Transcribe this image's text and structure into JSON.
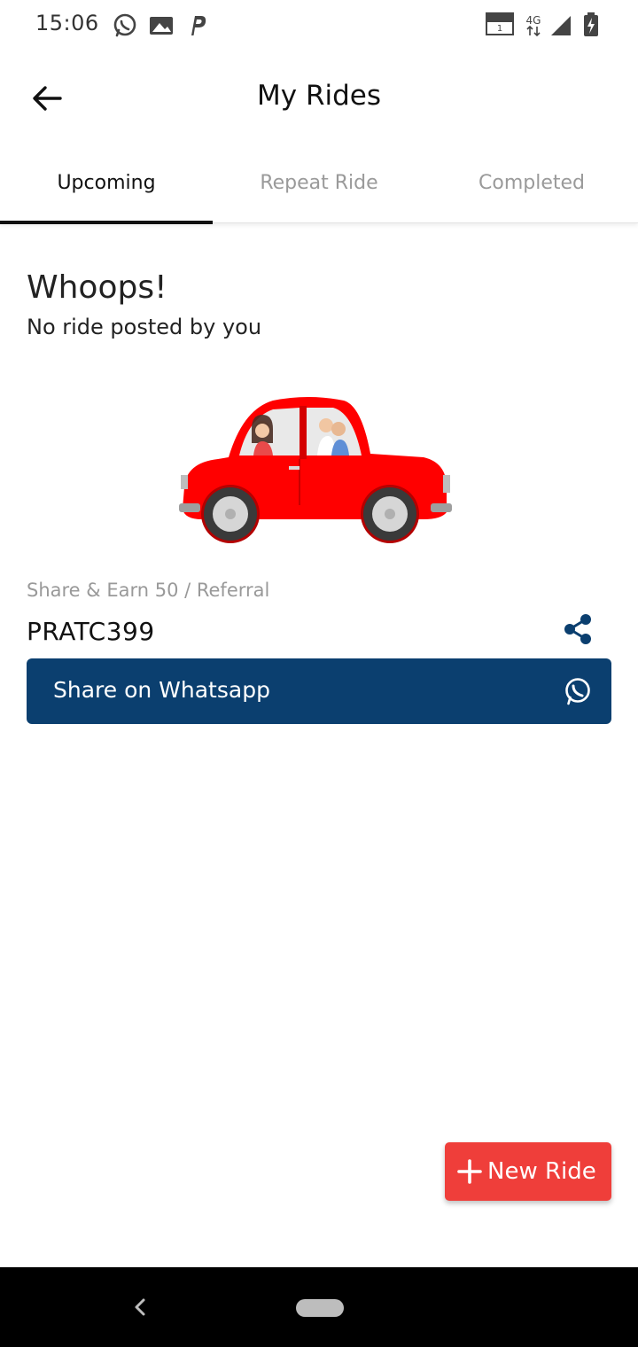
{
  "status_bar": {
    "time": "15:06",
    "icons": [
      "whatsapp-icon",
      "gallery-icon",
      "paytm-icon",
      "volte-icon",
      "4g-icon",
      "signal-icon",
      "battery-charging-icon"
    ]
  },
  "header": {
    "title": "My Rides",
    "back_icon": "arrow-left-icon"
  },
  "tabs": [
    {
      "label": "Upcoming",
      "active": true
    },
    {
      "label": "Repeat Ride",
      "active": false
    },
    {
      "label": "Completed",
      "active": false
    }
  ],
  "empty_state": {
    "title": "Whoops!",
    "subtitle": "No ride posted by you",
    "illustration": "car-with-passengers-illustration"
  },
  "referral": {
    "label": "Share & Earn 50 / Referral",
    "code": "PRATC399",
    "share_icon": "share-icon"
  },
  "whatsapp_button": {
    "label": "Share on Whatsapp",
    "icon": "whatsapp-icon"
  },
  "fab": {
    "label": "New Ride",
    "icon": "plus-icon"
  },
  "colors": {
    "primary_blue": "#0b3f6f",
    "accent_red": "#ef3e3a",
    "car_red": "#ff0000"
  }
}
